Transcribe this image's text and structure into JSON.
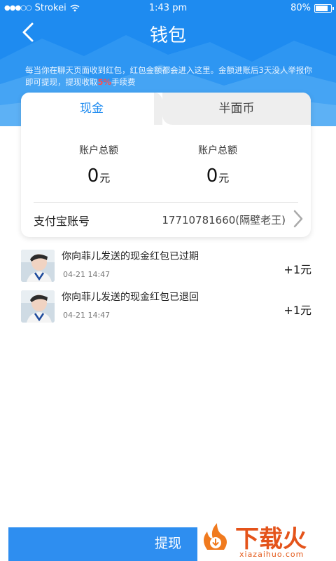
{
  "status_bar": {
    "carrier": "Strokei",
    "time": "1:43 pm",
    "battery": "80%"
  },
  "header": {
    "title": "钱包",
    "notice_before": "每当你在聊天页面收到红包，红包金额都会进入这里。金额进账后3天没人举报你即可提现，提现收取",
    "notice_fee": "5%",
    "notice_after": "手续费"
  },
  "tabs": [
    {
      "label": "现金",
      "active": true
    },
    {
      "label": "半面币",
      "active": false
    }
  ],
  "balances": [
    {
      "label": "账户总额",
      "value": "0",
      "unit": "元"
    },
    {
      "label": "账户总额",
      "value": "0",
      "unit": "元"
    }
  ],
  "alipay": {
    "label": "支付宝账号",
    "value": "17710781660(隔壁老王)"
  },
  "records": [
    {
      "title": "你向菲儿发送的现金红包已过期",
      "time": "04-21 14:47",
      "amount": "+1元"
    },
    {
      "title": "你向菲儿发送的现金红包已退回",
      "time": "04-21 14:47",
      "amount": "+1元"
    }
  ],
  "withdraw_button": "提现",
  "watermark": {
    "logo_text": "下载火",
    "site": "xiazaihuo.com"
  },
  "colors": {
    "header_blue": "#1e8bf0",
    "button_blue": "#2e8ef0",
    "fee_red": "#ff4d4d",
    "watermark_orange": "#e45a1a"
  }
}
